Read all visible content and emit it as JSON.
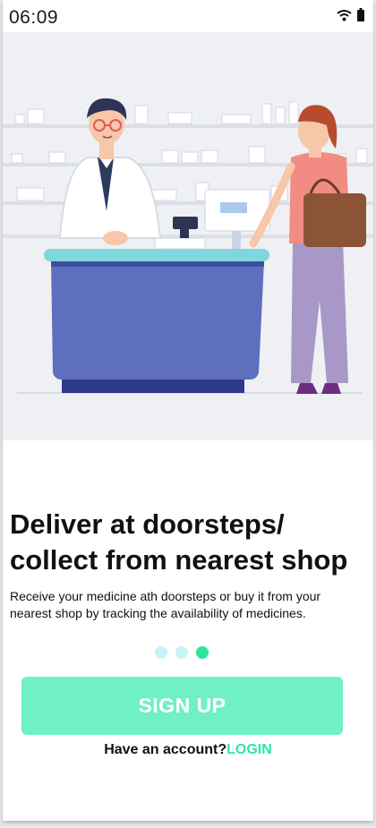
{
  "status_bar": {
    "time": "06:09",
    "icons": [
      "wifi-icon",
      "battery-icon"
    ]
  },
  "hero": {
    "illustration": "pharmacist-counter-illustration"
  },
  "onboarding": {
    "title_line1": "Deliver at doorsteps/",
    "title_line2": "collect from nearest shop",
    "description": "Receive your medicine ath doorsteps or buy it from your nearest shop by tracking the availability of medicines.",
    "pages": 3,
    "current_page": 3
  },
  "actions": {
    "signup_label": "SIGN UP",
    "account_prompt": "Have an account?",
    "login_label": "LOGIN"
  },
  "colors": {
    "accent": "#2ee69b",
    "button": "#6ff0c6",
    "dot_inactive": "#c8f3f7",
    "hero_background": "#eef0f4"
  }
}
